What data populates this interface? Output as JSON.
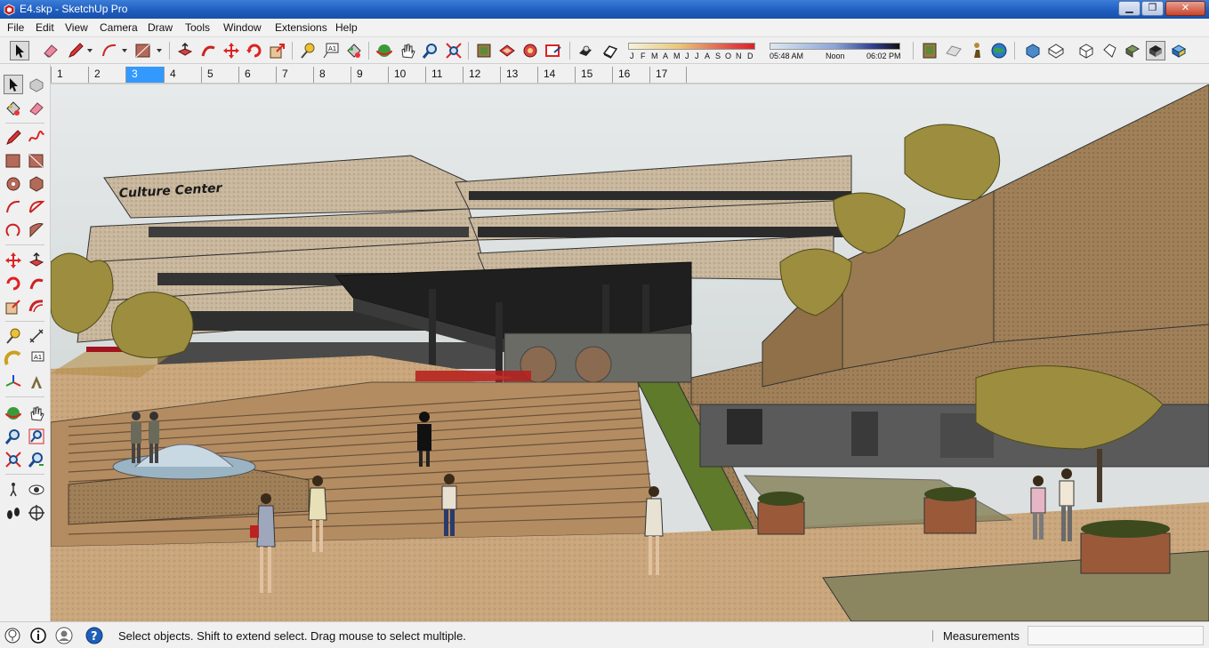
{
  "window": {
    "title": "E4.skp - SketchUp Pro",
    "controls": {
      "minimize": "▁",
      "maximize": "❐",
      "close": "✕"
    }
  },
  "menu": {
    "items": [
      {
        "label": "File"
      },
      {
        "label": "Edit"
      },
      {
        "label": "View"
      },
      {
        "label": "Camera"
      },
      {
        "label": "Draw"
      },
      {
        "label": "Tools"
      },
      {
        "label": "Window"
      },
      {
        "label": "Extensions"
      },
      {
        "label": "Help"
      }
    ]
  },
  "toolbar": {
    "tools": [
      "select-icon",
      "eraser-icon",
      "pencil-icon",
      "arc-icon",
      "rectangle-icon",
      "push-pull-icon",
      "follow-me-icon",
      "move-icon",
      "rotate-icon",
      "scale-icon",
      "tape-measure-icon",
      "text-icon",
      "paint-bucket-icon",
      "orbit-icon",
      "pan-icon",
      "zoom-icon",
      "zoom-extents-icon",
      "warehouse-icon",
      "extension-warehouse-icon",
      "components-icon",
      "send-icon",
      "shadows-icon",
      "fog-icon"
    ],
    "shadow_months": [
      "J",
      "F",
      "M",
      "A",
      "M",
      "J",
      "J",
      "A",
      "S",
      "O",
      "N",
      "D"
    ],
    "shadow_time": {
      "start": "05:48 AM",
      "mid": "Noon",
      "end": "06:02 PM"
    },
    "styles": [
      "model-info-icon",
      "section-plane-icon",
      "walk-icon",
      "geo-location-icon",
      "iso-view-icon",
      "top-view-icon",
      "front-view-icon",
      "right-view-icon",
      "back-view-icon",
      "monochrome-icon",
      "shaded-icon"
    ],
    "colors": {
      "accent_active": "#3399ff",
      "titlebar": "#1d5bbd"
    }
  },
  "scenes": {
    "tabs": [
      "1",
      "2",
      "3",
      "4",
      "5",
      "6",
      "7",
      "8",
      "9",
      "10",
      "11",
      "12",
      "13",
      "14",
      "15",
      "16",
      "17"
    ],
    "active_index": 2
  },
  "left_toolbar": {
    "tools": [
      "select-icon",
      "make-component-icon",
      "paint-bucket-icon",
      "eraser-icon",
      "line-icon",
      "freehand-icon",
      "rectangle-icon",
      "rotated-rectangle-icon",
      "circle-icon",
      "polygon-icon",
      "arc-icon",
      "two-point-arc-icon",
      "three-point-arc-icon",
      "pie-icon",
      "move-icon",
      "push-pull-icon",
      "rotate-icon",
      "follow-me-icon",
      "scale-icon",
      "offset-icon",
      "tape-measure-icon",
      "dimension-icon",
      "protractor-icon",
      "text-icon",
      "axes-icon",
      "3d-text-icon",
      "orbit-icon",
      "pan-icon",
      "zoom-icon",
      "zoom-window-icon",
      "zoom-extents-icon",
      "previous-view-icon",
      "position-camera-icon",
      "look-around-icon",
      "walk-icon",
      "section-plane-icon"
    ]
  },
  "viewport": {
    "sign_text": "Culture Center",
    "sky_color": "#dfe4e4",
    "ground_color": "#c6a37a"
  },
  "statusbar": {
    "icons": [
      "geo-location-icon",
      "credits-icon",
      "user-icon",
      "help-icon"
    ],
    "message": "Select objects. Shift to extend select. Drag mouse to select multiple.",
    "measurements_label": "Measurements",
    "measurements_value": ""
  }
}
